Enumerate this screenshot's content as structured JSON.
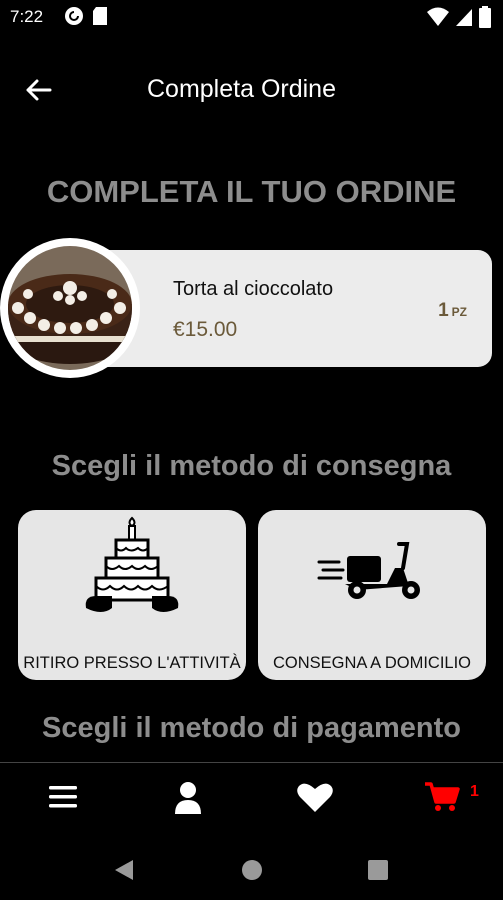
{
  "status_bar": {
    "time": "7:22",
    "left_icons": [
      "pocket-casts-icon",
      "sd-card-icon"
    ],
    "right_icons": [
      "wifi-icon",
      "signal-icon",
      "battery-icon"
    ]
  },
  "app_bar": {
    "title": "Completa Ordine",
    "back_icon": "arrow-left-icon"
  },
  "main": {
    "heading": "COMPLETA IL TUO ORDINE",
    "product": {
      "name": "Torta al cioccolato",
      "price": "€15.00",
      "quantity": "1",
      "unit": "PZ",
      "image": "chocolate-cake-image"
    },
    "delivery_heading": "Scegli il metodo di consegna",
    "delivery_options": [
      {
        "label": "RITIRO PRESSO L'ATTIVITÀ",
        "icon": "cake-pickup-icon"
      },
      {
        "label": "CONSEGNA A DOMICILIO",
        "icon": "scooter-icon"
      }
    ],
    "payment_heading": "Scegli il metodo di pagamento"
  },
  "bottom_nav": {
    "items": [
      {
        "icon": "menu-icon"
      },
      {
        "icon": "user-icon"
      },
      {
        "icon": "heart-icon"
      },
      {
        "icon": "cart-icon"
      }
    ],
    "cart_count": "1",
    "accent_color": "#ff0000"
  },
  "system_nav": [
    "back-triangle-icon",
    "home-circle-icon",
    "recents-square-icon"
  ]
}
